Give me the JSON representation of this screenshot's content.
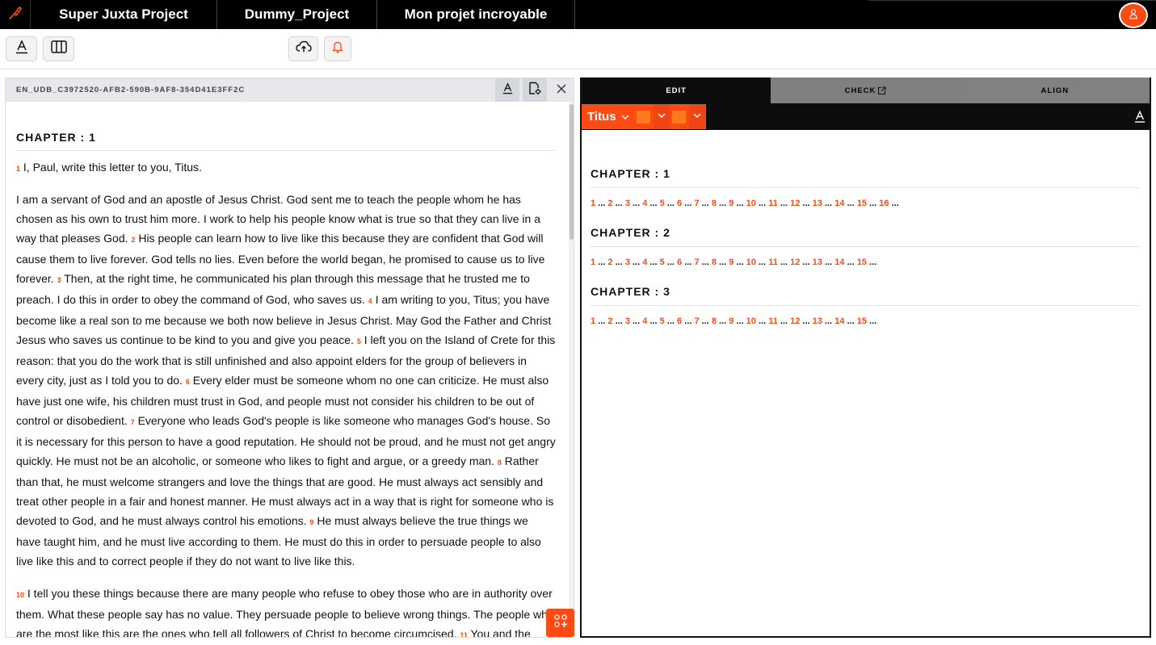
{
  "topbar": {
    "projects": [
      "Super Juxta Project",
      "Dummy_Project",
      "Mon projet incroyable"
    ]
  },
  "left": {
    "resource_id": "EN_UDB_C3972520-AFB2-590B-9AF8-354D41E3FF2C",
    "chapter_title": "CHAPTER : 1",
    "v1_num": "1",
    "v1_text": "I, Paul, write this letter to you, Titus.",
    "p2a": "I am a servant of God and an apostle of Jesus Christ. God sent me to teach the people whom he has chosen as his own to trust him more. I work to help his people know what is true so that they can live in a way that pleases God.",
    "v2_num": "2",
    "v2_text": "His people can learn how to live like this because they are confident that God will cause them to live forever. God tells no lies. Even before the world began, he promised to cause us to live forever.",
    "v3_num": "3",
    "v3_text": "Then, at the right time, he communicated his plan through this message that he trusted me to preach. I do this in order to obey the command of God, who saves us.",
    "v4_num": "4",
    "v4_text": "I am writing to you, Titus; you have become like a real son to me because we both now believe in Jesus Christ. May God the Father and Christ Jesus who saves us continue to be kind to you and give you peace.",
    "v5_num": "5",
    "v5_text": "I left you on the Island of Crete for this reason: that you do the work that is still unfinished and also appoint elders for the group of believers in every city, just as I told you to do.",
    "v6_num": "6",
    "v6_text": "Every elder must be someone whom no one can criticize. He must also have just one wife, his children must trust in God, and people must not consider his children to be out of control or disobedient.",
    "v7_num": "7",
    "v7_text": "Everyone who leads God's people is like someone who manages God's house. So it is necessary for this person to have a good reputation. He should not be proud, and he must not get angry quickly. He must not be an alcoholic, or someone who likes to fight and argue, or a greedy man.",
    "v8_num": "8",
    "v8_text": "Rather than that, he must welcome strangers and love the things that are good. He must always act sensibly and treat other people in a fair and honest manner. He must always act in a way that is right for someone who is devoted to God, and he must always control his emotions.",
    "v9_num": "9",
    "v9_text": "He must always believe the true things we have taught him, and he must live according to them. He must do this in order to persuade people to also live like this and to correct people if they do not want to live like this.",
    "v10_num": "10",
    "v10_text": "I tell you these things because there are many people who refuse to obey those who are in authority over them. What these people say has no value. They persuade people to believe wrong things. The people who are the most like this are the ones who tell all followers of Christ to become circumcised.",
    "v11_num": "11",
    "v11_text": "You and the leaders whom you appoint should prevent such people from teaching the believers. They are teaching"
  },
  "right": {
    "tabs": [
      "EDIT",
      "CHECK",
      "ALIGN"
    ],
    "book": "Titus",
    "chapters": [
      {
        "title": "CHAPTER : 1",
        "verses": [
          "1",
          "2",
          "3",
          "4",
          "5",
          "6",
          "7",
          "8",
          "9",
          "10",
          "11",
          "12",
          "13",
          "14",
          "15",
          "16"
        ]
      },
      {
        "title": "CHAPTER : 2",
        "verses": [
          "1",
          "2",
          "3",
          "4",
          "5",
          "6",
          "7",
          "8",
          "9",
          "10",
          "11",
          "12",
          "13",
          "14",
          "15"
        ]
      },
      {
        "title": "CHAPTER : 3",
        "verses": [
          "1",
          "2",
          "3",
          "4",
          "5",
          "6",
          "7",
          "8",
          "9",
          "10",
          "11",
          "12",
          "13",
          "14",
          "15"
        ]
      }
    ],
    "ellipsis": "..."
  },
  "colors": {
    "accent": "#ff4a14",
    "topbar": "#000000",
    "tab_active": "#0d0d0d",
    "tab_inactive": "#808080"
  },
  "icons": [
    "brush-logo-icon",
    "user-icon",
    "font-icon",
    "columns-icon",
    "cloud-upload-icon",
    "bell-icon",
    "file-settings-icon",
    "close-icon",
    "external-link-icon",
    "chevron-down-icon",
    "add-grid-icon"
  ]
}
